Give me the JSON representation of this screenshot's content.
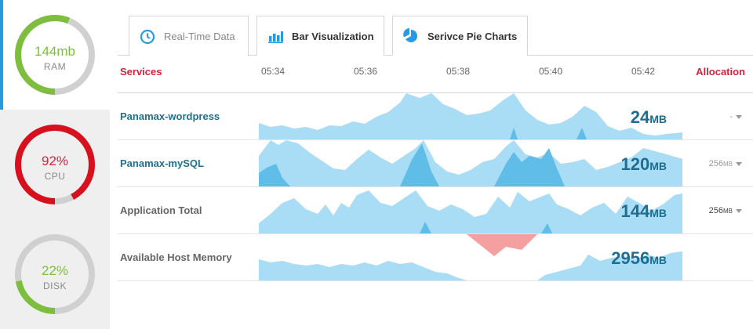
{
  "gauges": [
    {
      "value": "144mb",
      "label": "RAM",
      "percent": 56,
      "color": "#7dbe3e",
      "value_color": "#7dbe3e",
      "active": true
    },
    {
      "value": "92%",
      "label": "CPU",
      "percent": 92,
      "color": "#d7101e",
      "value_color": "#d0253e",
      "active": false
    },
    {
      "value": "22%",
      "label": "DISK",
      "percent": 22,
      "color": "#7dbe3e",
      "value_color": "#7dbe3e",
      "active": false
    }
  ],
  "tabs": [
    {
      "label": "Real-Time Data",
      "icon": "clock-icon"
    },
    {
      "label": "Bar Visualization",
      "icon": "bar-chart-icon"
    },
    {
      "label": "Serivce Pie Charts",
      "icon": "pie-chart-icon"
    }
  ],
  "header": {
    "services": "Services",
    "allocation": "Allocation",
    "times": [
      "05:34",
      "05:36",
      "05:38",
      "05:40",
      "05:42"
    ]
  },
  "rows": [
    {
      "name": "Panamax-wordpress",
      "value": "24",
      "unit": "MB",
      "alloc": "-",
      "name_style": "link"
    },
    {
      "name": "Panamax-mySQL",
      "value": "120",
      "unit": "MB",
      "alloc": "256",
      "alloc_unit": "MB",
      "name_style": "link"
    },
    {
      "name": "Application Total",
      "value": "144",
      "unit": "MB",
      "alloc": "256",
      "alloc_unit": "MB",
      "name_style": "plain"
    },
    {
      "name": "Available Host Memory",
      "value": "2956",
      "unit": "MB",
      "alloc": "",
      "name_style": "plain"
    }
  ],
  "colors": {
    "accent": "#2a9ae0",
    "area_light": "#a9dcf5",
    "area_dark": "#5fbde8",
    "negative": "#f5a0a0",
    "title_red": "#d0253e"
  }
}
